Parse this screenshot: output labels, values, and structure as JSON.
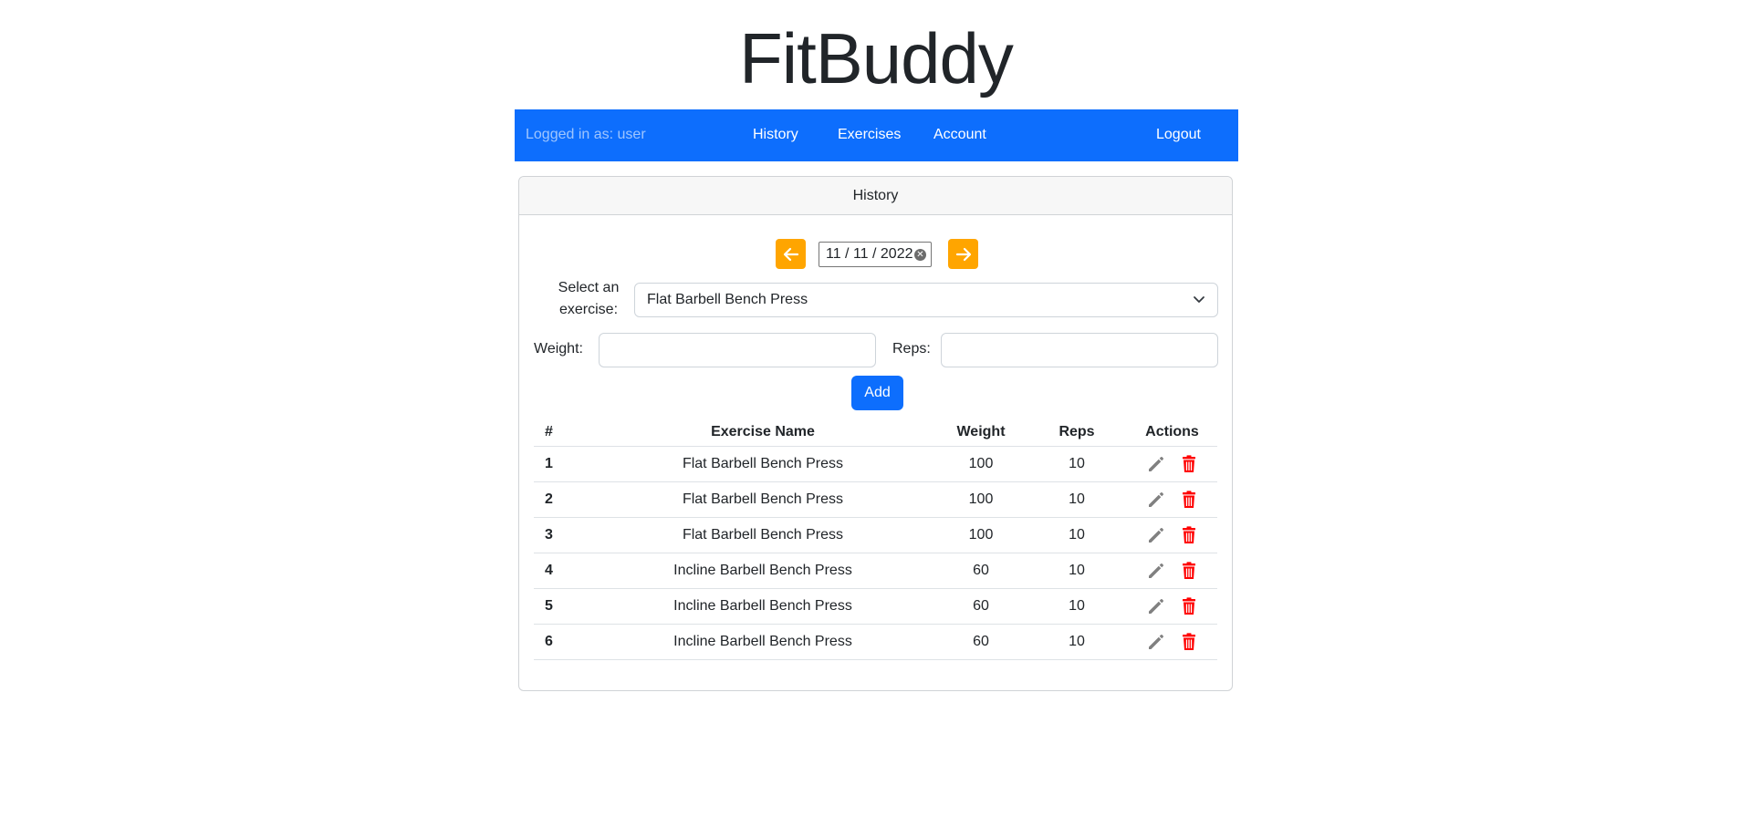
{
  "app": {
    "title": "FitBuddy"
  },
  "navbar": {
    "logged_in_text": "Logged in as: user",
    "links": [
      "History",
      "Exercises",
      "Account"
    ],
    "logout_label": "Logout",
    "color": "#0d6efd"
  },
  "card": {
    "header": "History"
  },
  "date_picker": {
    "value": "11 / 11 / 2022",
    "prev_icon": "arrow-left-icon",
    "next_icon": "arrow-right-icon",
    "clear_icon": "clear-icon",
    "accent": "#ffa500"
  },
  "exercise_select": {
    "label_line1": "Select an",
    "label_line2": "exercise:",
    "selected": "Flat Barbell Bench Press"
  },
  "weight": {
    "label": "Weight:",
    "value": ""
  },
  "reps": {
    "label": "Reps:",
    "value": ""
  },
  "add_button": {
    "label": "Add"
  },
  "table": {
    "headers": [
      "#",
      "Exercise Name",
      "Weight",
      "Reps",
      "Actions"
    ],
    "rows": [
      {
        "num": "1",
        "name": "Flat Barbell Bench Press",
        "weight": "100",
        "reps": "10"
      },
      {
        "num": "2",
        "name": "Flat Barbell Bench Press",
        "weight": "100",
        "reps": "10"
      },
      {
        "num": "3",
        "name": "Flat Barbell Bench Press",
        "weight": "100",
        "reps": "10"
      },
      {
        "num": "4",
        "name": "Incline Barbell Bench Press",
        "weight": "60",
        "reps": "10"
      },
      {
        "num": "5",
        "name": "Incline Barbell Bench Press",
        "weight": "60",
        "reps": "10"
      },
      {
        "num": "6",
        "name": "Incline Barbell Bench Press",
        "weight": "60",
        "reps": "10"
      }
    ],
    "edit_icon": "pencil-icon",
    "delete_icon": "trash-icon",
    "delete_color": "#ff0000"
  }
}
